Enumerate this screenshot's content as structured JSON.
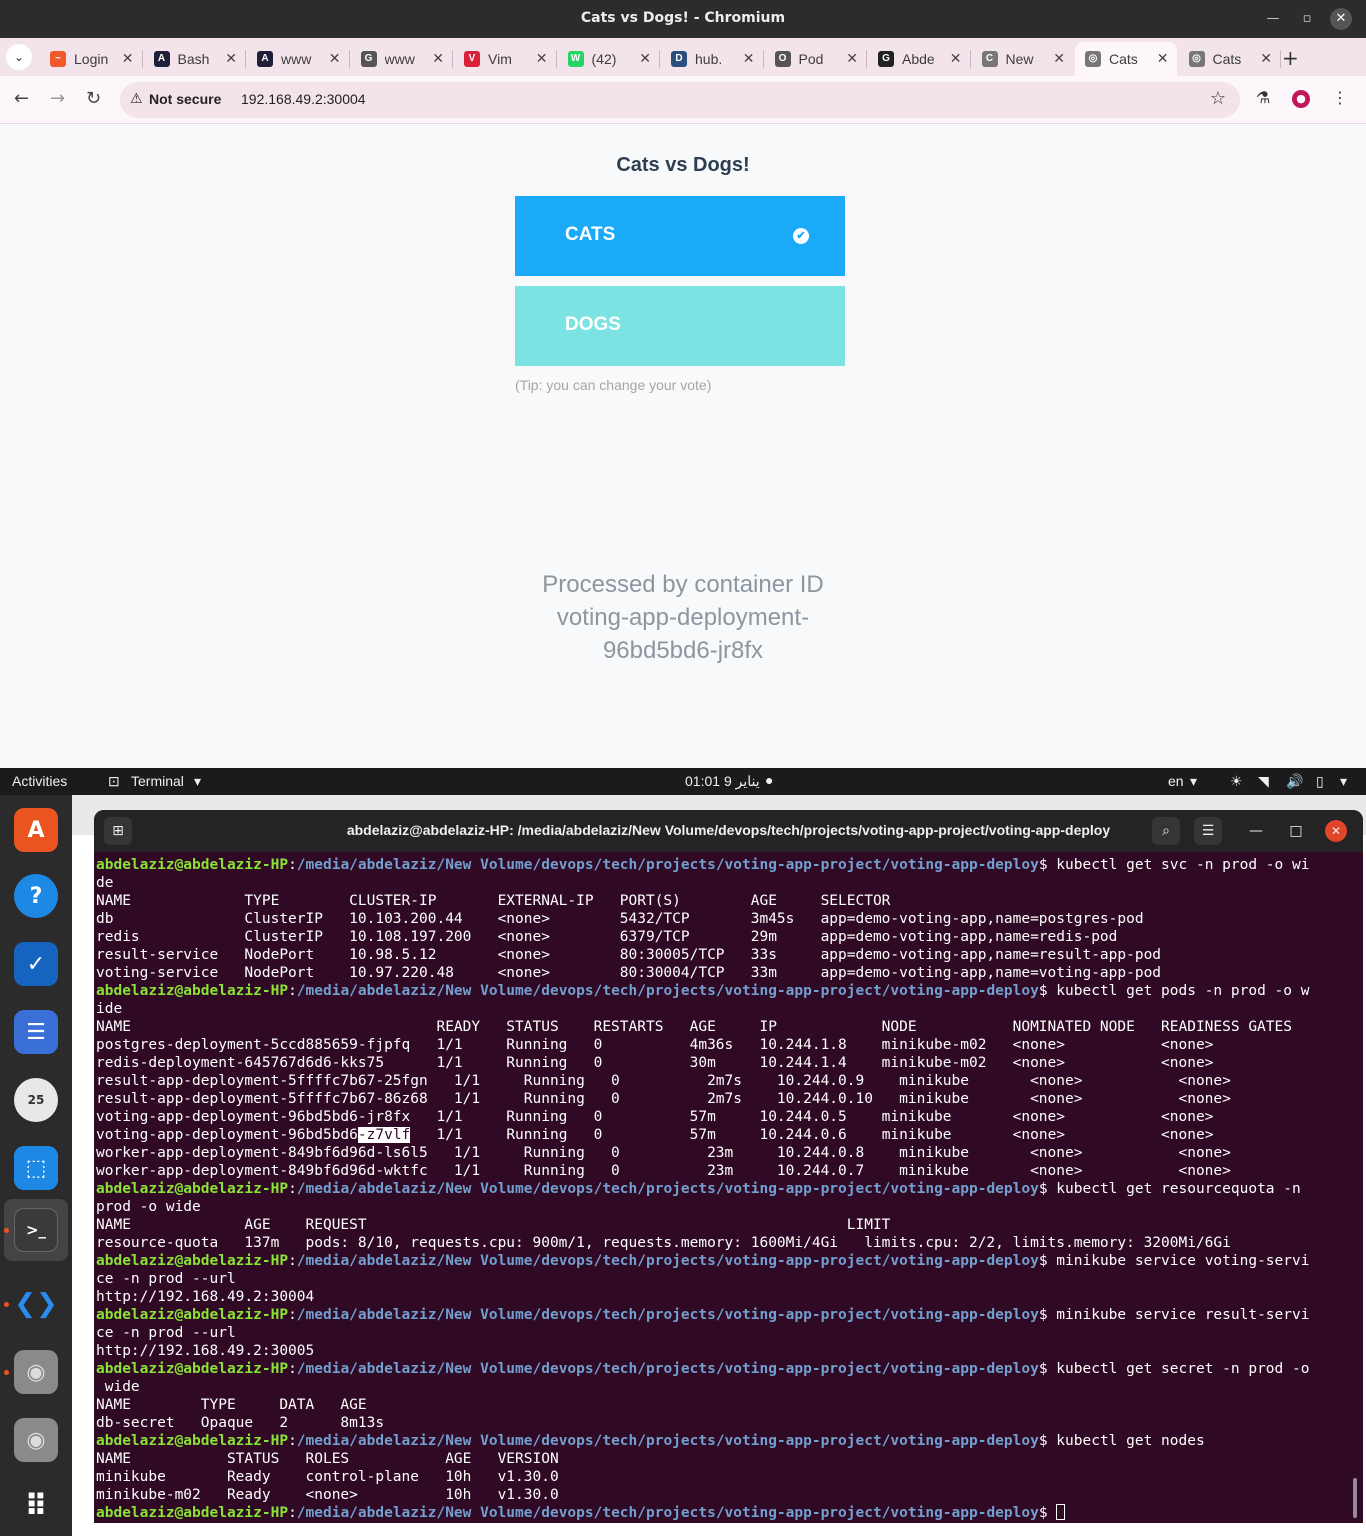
{
  "browser": {
    "window_title": "Cats vs Dogs! - Chromium",
    "tabs": [
      {
        "label": "Login",
        "fav_color": "#f05a28",
        "fav_glyph": "~"
      },
      {
        "label": "Bash",
        "fav_color": "#1f1f3a",
        "fav_glyph": "A"
      },
      {
        "label": "www",
        "fav_color": "#1f1f3a",
        "fav_glyph": "A"
      },
      {
        "label": "www",
        "fav_color": "#555555",
        "fav_glyph": "G"
      },
      {
        "label": "Vim",
        "fav_color": "#d9213a",
        "fav_glyph": "V"
      },
      {
        "label": "(42)",
        "fav_color": "#25d366",
        "fav_glyph": "W"
      },
      {
        "label": "hub.",
        "fav_color": "#2b4f7e",
        "fav_glyph": "D"
      },
      {
        "label": "Pod",
        "fav_color": "#555555",
        "fav_glyph": "O"
      },
      {
        "label": "Abde",
        "fav_color": "#222222",
        "fav_glyph": "G"
      },
      {
        "label": "New",
        "fav_color": "#777777",
        "fav_glyph": "C"
      },
      {
        "label": "Cats",
        "fav_color": "#777777",
        "fav_glyph": "◎"
      },
      {
        "label": "Cats",
        "fav_color": "#777777",
        "fav_glyph": "◎"
      }
    ],
    "active_tab_index": 10,
    "omnibox": {
      "security_label": "Not secure",
      "url": "192.168.49.2:30004"
    }
  },
  "app": {
    "title": "Cats vs Dogs!",
    "option_a": {
      "label": "CATS",
      "color": "#1aaaf8",
      "selected": true
    },
    "option_b": {
      "label": "DOGS",
      "color": "#7be3e2",
      "selected": false
    },
    "tip": "(Tip: you can change your vote)",
    "processed_line1": "Processed by container ID",
    "processed_line2": "voting-app-deployment-",
    "processed_line3": "96bd5bd6-jr8fx"
  },
  "topbar": {
    "activities": "Activities",
    "app_name": "Terminal",
    "clock": "01:01 يناير 9",
    "language": "en"
  },
  "terminal": {
    "window_title": "abdelaziz@abdelaziz-HP: /media/abdelaziz/New Volume/devops/tech/projects/voting-app-project/voting-app-deploy",
    "prompt_user": "abdelaziz@abdelaziz-HP",
    "prompt_path": "/media/abdelaziz/New Volume/devops/tech/projects/voting-app-project/voting-app-deploy",
    "lines": [
      {
        "kind": "prompt",
        "cmd": " kubectl get svc -n prod -o wi"
      },
      {
        "kind": "out",
        "text": "de"
      },
      {
        "kind": "out",
        "text": "NAME             TYPE        CLUSTER-IP       EXTERNAL-IP   PORT(S)        AGE     SELECTOR"
      },
      {
        "kind": "out",
        "text": "db               ClusterIP   10.103.200.44    <none>        5432/TCP       3m45s   app=demo-voting-app,name=postgres-pod"
      },
      {
        "kind": "out",
        "text": "redis            ClusterIP   10.108.197.200   <none>        6379/TCP       29m     app=demo-voting-app,name=redis-pod"
      },
      {
        "kind": "out",
        "text": "result-service   NodePort    10.98.5.12       <none>        80:30005/TCP   33s     app=demo-voting-app,name=result-app-pod"
      },
      {
        "kind": "out",
        "text": "voting-service   NodePort    10.97.220.48     <none>        80:30004/TCP   33m     app=demo-voting-app,name=voting-app-pod"
      },
      {
        "kind": "prompt",
        "cmd": " kubectl get pods -n prod -o w"
      },
      {
        "kind": "out",
        "text": "ide"
      },
      {
        "kind": "out",
        "text": "NAME                                   READY   STATUS    RESTARTS   AGE     IP            NODE           NOMINATED NODE   READINESS GATES"
      },
      {
        "kind": "out",
        "text": "postgres-deployment-5ccd885659-fjpfq   1/1     Running   0          4m36s   10.244.1.8    minikube-m02   <none>           <none>"
      },
      {
        "kind": "out",
        "text": "redis-deployment-645767d6d6-kks75      1/1     Running   0          30m     10.244.1.4    minikube-m02   <none>           <none>"
      },
      {
        "kind": "out",
        "text": "result-app-deployment-5ffffc7b67-25fgn   1/1     Running   0          2m7s    10.244.0.9    minikube       <none>           <none>"
      },
      {
        "kind": "out",
        "text": "result-app-deployment-5ffffc7b67-86z68   1/1     Running   0          2m7s    10.244.0.10   minikube       <none>           <none>"
      },
      {
        "kind": "out",
        "text": "voting-app-deployment-96bd5bd6-jr8fx   1/1     Running   0          57m     10.244.0.5    minikube       <none>           <none>"
      },
      {
        "kind": "hl",
        "pre": "voting-app-deployment-96bd5bd6",
        "mark": "-z7vlf",
        "post": "   1/1     Running   0          57m     10.244.0.6    minikube       <none>           <none>"
      },
      {
        "kind": "out",
        "text": "worker-app-deployment-849bf6d96d-ls6l5   1/1     Running   0          23m     10.244.0.8    minikube       <none>           <none>"
      },
      {
        "kind": "out",
        "text": "worker-app-deployment-849bf6d96d-wktfc   1/1     Running   0          23m     10.244.0.7    minikube       <none>           <none>"
      },
      {
        "kind": "prompt",
        "cmd": " kubectl get resourcequota -n"
      },
      {
        "kind": "out",
        "text": "prod -o wide"
      },
      {
        "kind": "out",
        "text": "NAME             AGE    REQUEST                                                       LIMIT"
      },
      {
        "kind": "out",
        "text": "resource-quota   137m   pods: 8/10, requests.cpu: 900m/1, requests.memory: 1600Mi/4Gi   limits.cpu: 2/2, limits.memory: 3200Mi/6Gi"
      },
      {
        "kind": "prompt",
        "cmd": " minikube service voting-servi"
      },
      {
        "kind": "out",
        "text": "ce -n prod --url"
      },
      {
        "kind": "out",
        "text": "http://192.168.49.2:30004"
      },
      {
        "kind": "prompt",
        "cmd": " minikube service result-servi"
      },
      {
        "kind": "out",
        "text": "ce -n prod --url"
      },
      {
        "kind": "out",
        "text": "http://192.168.49.2:30005"
      },
      {
        "kind": "prompt",
        "cmd": " kubectl get secret -n prod -o"
      },
      {
        "kind": "out",
        "text": " wide"
      },
      {
        "kind": "out",
        "text": "NAME        TYPE     DATA   AGE"
      },
      {
        "kind": "out",
        "text": "db-secret   Opaque   2      8m13s"
      },
      {
        "kind": "prompt",
        "cmd": " kubectl get nodes"
      },
      {
        "kind": "out",
        "text": "NAME           STATUS   ROLES           AGE   VERSION"
      },
      {
        "kind": "out",
        "text": "minikube       Ready    control-plane   10h   v1.30.0"
      },
      {
        "kind": "out",
        "text": "minikube-m02   Ready    <none>          10h   v1.30.0"
      },
      {
        "kind": "cursor",
        "cmd": " "
      }
    ]
  },
  "dock": {
    "items": [
      {
        "name": "app-center-icon",
        "glyph": "A",
        "color": "#e95420",
        "running": false
      },
      {
        "name": "help-icon",
        "glyph": "?",
        "color": "#1e88e5",
        "running": false
      },
      {
        "name": "todo-icon",
        "glyph": "✓",
        "color": "#1565c0",
        "running": false
      },
      {
        "name": "checklist-icon",
        "glyph": "☰",
        "color": "#3a6fd8",
        "running": false
      },
      {
        "name": "timer-icon",
        "glyph": "25",
        "color": "#e8e8e8",
        "running": false
      },
      {
        "name": "screenshot-icon",
        "glyph": "⬚",
        "color": "#1e88e5",
        "running": false
      },
      {
        "name": "terminal-icon",
        "glyph": ">_",
        "color": "#3a3a3a",
        "running": true
      },
      {
        "name": "vscode-icon",
        "glyph": "❮❯",
        "color": "#1f7bd8",
        "running": true
      },
      {
        "name": "disk-icon",
        "glyph": "◉",
        "color": "#8a8a8a",
        "running": true
      },
      {
        "name": "disk-icon-2",
        "glyph": "◉",
        "color": "#8a8a8a",
        "running": false
      },
      {
        "name": "show-apps-icon",
        "glyph": "⠿",
        "color": "#2b2b2b",
        "running": false
      }
    ]
  }
}
